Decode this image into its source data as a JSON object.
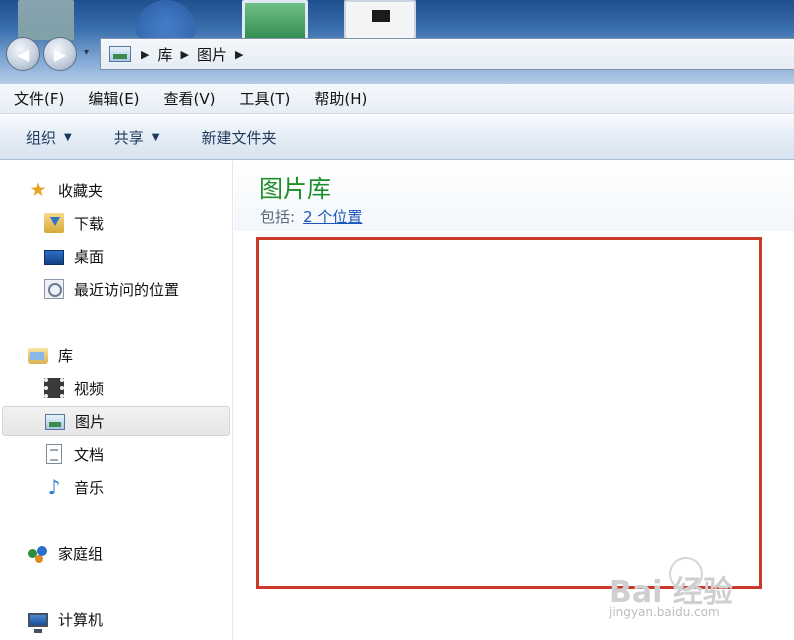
{
  "toolbar": {
    "nav_back_symbol": "◀",
    "nav_forward_symbol": "▶",
    "nav_dropdown_symbol": "▾"
  },
  "address_bar": {
    "icon": "pictures-library-icon",
    "breadcrumb_separator": "▶",
    "crumbs": [
      "库",
      "图片"
    ]
  },
  "menu": {
    "items": [
      "文件(F)",
      "编辑(E)",
      "查看(V)",
      "工具(T)",
      "帮助(H)"
    ]
  },
  "command_bar": {
    "organize": "组织",
    "share": "共享",
    "new_folder": "新建文件夹",
    "dropdown_symbol": "▼"
  },
  "sidebar": {
    "favorites": {
      "label": "收藏夹",
      "icon_symbol": "★",
      "items": [
        {
          "label": "下载",
          "icon": "downloads-icon"
        },
        {
          "label": "桌面",
          "icon": "desktop-icon"
        },
        {
          "label": "最近访问的位置",
          "icon": "recent-places-icon"
        }
      ]
    },
    "libraries": {
      "label": "库",
      "items": [
        {
          "label": "视频",
          "icon": "video-library-icon"
        },
        {
          "label": "图片",
          "icon": "pictures-library-icon",
          "selected": true
        },
        {
          "label": "文档",
          "icon": "documents-library-icon"
        },
        {
          "label": "音乐",
          "icon": "music-library-icon",
          "icon_symbol": "♪"
        }
      ]
    },
    "homegroup": {
      "label": "家庭组"
    },
    "computer": {
      "label": "计算机"
    }
  },
  "content": {
    "library_title": "图片库",
    "includes_label": "包括:",
    "includes_link": "2 个位置"
  },
  "highlight_color": "#c93a2a",
  "watermark": {
    "main": "Bai 经验",
    "sub": "jingyan.baidu.com"
  }
}
